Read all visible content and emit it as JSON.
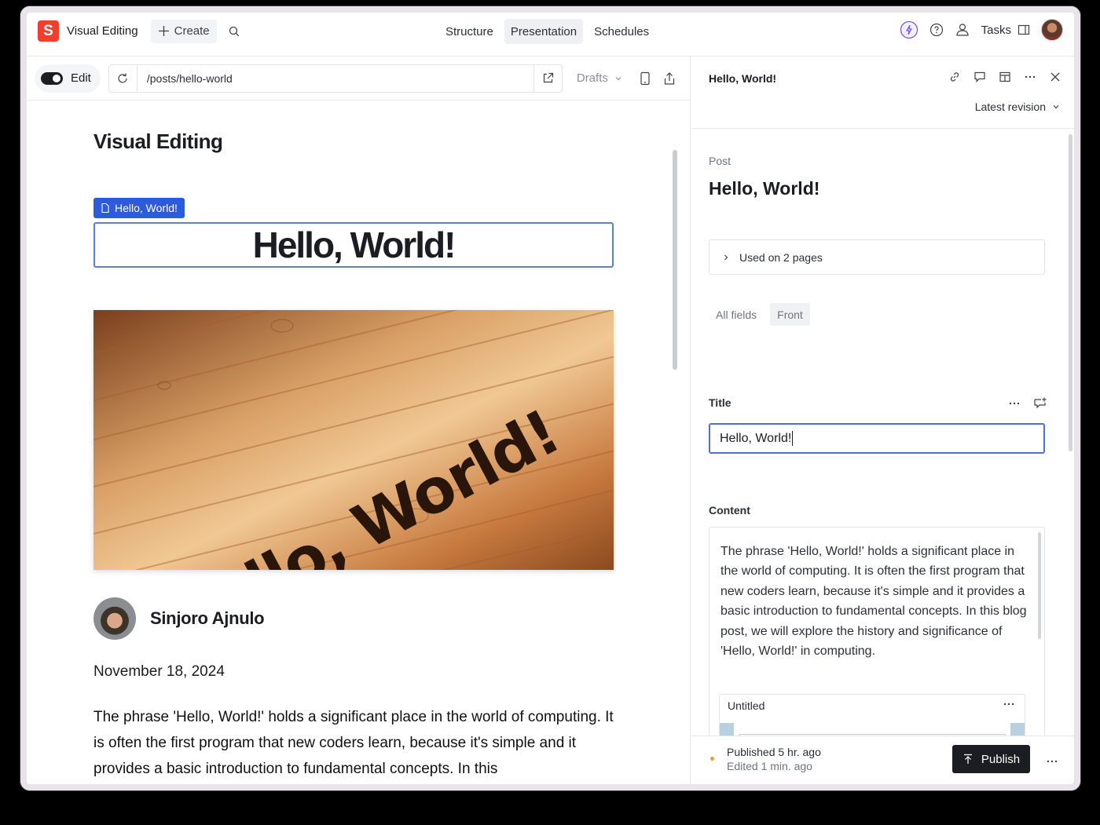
{
  "app": {
    "logo_letter": "S",
    "title": "Visual Editing",
    "create_label": "Create"
  },
  "nav": {
    "tabs": [
      {
        "label": "Structure"
      },
      {
        "label": "Presentation"
      },
      {
        "label": "Schedules"
      }
    ],
    "active_tab": "Presentation"
  },
  "top_right": {
    "tasks_label": "Tasks"
  },
  "preview_toolbar": {
    "edit_label": "Edit",
    "edit_on": true,
    "url": "/posts/hello-world",
    "perspective": "Drafts"
  },
  "preview": {
    "site_title": "Visual Editing",
    "overlay_chip": "Hello, World!",
    "headline": "Hello, World!",
    "image_text": "Hello, World!",
    "author_name": "Sinjoro Ajnulo",
    "date": "November 18, 2024",
    "body": "The phrase 'Hello, World!' holds a significant place in the world of computing. It is often the first program that new coders learn, because it's simple and it provides a basic introduction to fundamental concepts. In this"
  },
  "document": {
    "header_title": "Hello, World!",
    "revision": "Latest revision",
    "type_label": "Post",
    "title": "Hello, World!",
    "used_on": "Used on 2 pages",
    "field_tabs": [
      {
        "label": "All fields"
      },
      {
        "label": "Front"
      }
    ],
    "active_field_tab": "Front",
    "title_field_label": "Title",
    "title_value": "Hello, World!",
    "content_field_label": "Content",
    "content_text": "The phrase 'Hello, World!' holds a significant place in the world of computing. It is often the first program that new coders learn, because it's simple and it provides a basic introduction to fundamental concepts. In this blog post, we will explore the history and significance of 'Hello, World!' in computing.",
    "untitled_block": "Untitled"
  },
  "footer": {
    "published": "Published 5 hr. ago",
    "edited": "Edited 1 min. ago",
    "publish_label": "Publish"
  },
  "colors": {
    "brand": "#f03e2f",
    "accent": "#2e5bdb",
    "status_dot": "#f29d38",
    "publish_bg": "#1b1d23"
  }
}
